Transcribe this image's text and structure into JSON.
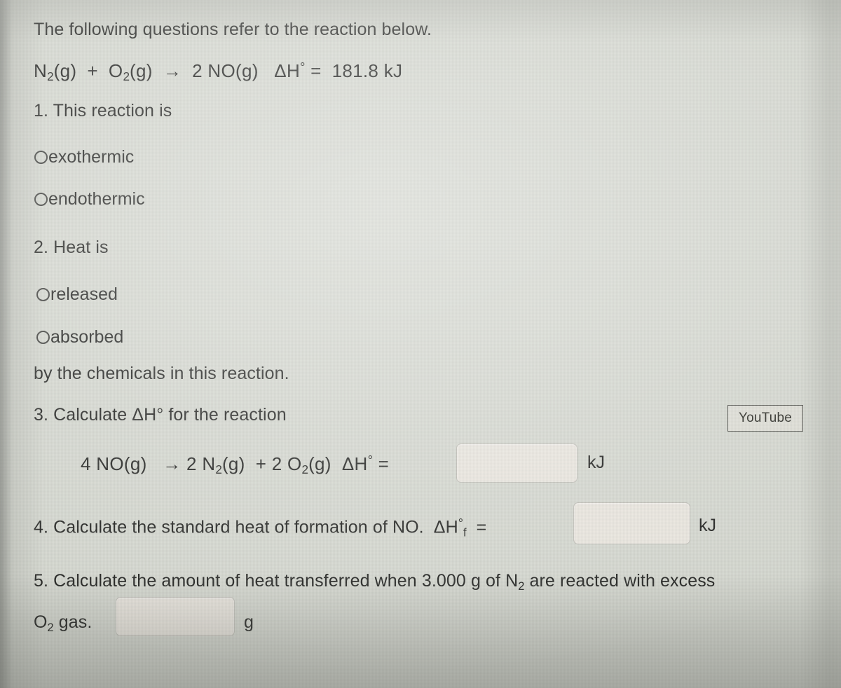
{
  "worksheet": {
    "intro": "The following questions refer to the reaction below.",
    "main_reaction": {
      "reactant_1": "N",
      "reactant_1_sub": "2",
      "reactant_1_state": "(g)",
      "plus": "+",
      "reactant_2": "O",
      "reactant_2_sub": "2",
      "reactant_2_state": "(g)",
      "arrow": "→",
      "product_coeff": "2",
      "product": "NO",
      "product_state": "(g)",
      "delta_h_symbol": "ΔH",
      "degree": "°",
      "equals": "=",
      "value": "181.8 kJ"
    },
    "questions": [
      {
        "number": "1.",
        "prompt": "1. This reaction is",
        "options": [
          {
            "label": "exothermic"
          },
          {
            "label": "endothermic"
          }
        ]
      },
      {
        "number": "2.",
        "prompt": "2. Heat is",
        "options": [
          {
            "label": "released"
          },
          {
            "label": "absorbed"
          }
        ],
        "trailer": "by the chemicals in this reaction."
      },
      {
        "number": "3.",
        "prompt": "3. Calculate ΔH° for the reaction",
        "equation": {
          "reactant_coeff": "4",
          "reactant": "NO",
          "reactant_state": "(g)",
          "arrow": "→",
          "product_1_coeff": "2",
          "product_1": "N",
          "product_1_sub": "2",
          "product_1_state": "(g)",
          "plus": "+",
          "product_2_coeff": "2",
          "product_2": "O",
          "product_2_sub": "2",
          "product_2_state": "(g)",
          "delta_h": "ΔH",
          "degree": "°",
          "equals": "="
        },
        "answer_value": "",
        "answer_unit": "kJ"
      },
      {
        "number": "4.",
        "prompt_part_1": "4. Calculate the standard heat of formation of NO.",
        "delta_h": "ΔH",
        "degree": "°",
        "subscript": "f",
        "equals": "=",
        "answer_value": "",
        "answer_unit": "kJ"
      },
      {
        "number": "5.",
        "prompt_part_1": "5. Calculate the amount of heat transferred when 3.000 g of N",
        "prompt_sub": "2",
        "prompt_part_2": " are reacted with excess",
        "prompt_line_2_element": "O",
        "prompt_line_2_sub": "2",
        "prompt_line_2_rest": " gas.",
        "answer_value": "",
        "answer_unit": "g"
      }
    ],
    "youtube_button_label": "YouTube"
  },
  "colors": {
    "screen_background": "#d3d6ce",
    "text": "#20211f",
    "input_fill": "#e8e4dd",
    "button_fill": "#dcdcd4"
  }
}
